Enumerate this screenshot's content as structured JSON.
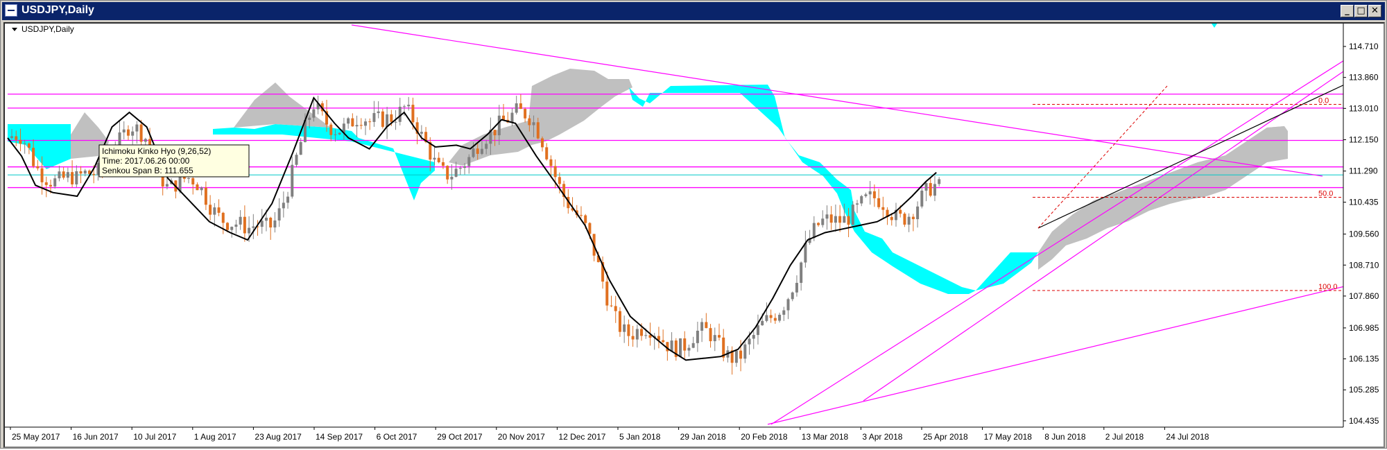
{
  "window": {
    "title": "USDJPY,Daily",
    "buttons": [
      "_",
      "□",
      "✕"
    ]
  },
  "chart_label": "USDJPY,Daily",
  "tooltip": {
    "line1": "Ichimoku Kinko Hyo (9,26,52)",
    "line2": "Time: 2017.06.26 00:00",
    "line3": "Senkou Span B: 111.655"
  },
  "colors": {
    "kumo_bull": "#00ffff",
    "kumo_bear": "#c0c0c0",
    "hline": "#ff00ff",
    "kijun": "#000000",
    "tenkan": "#dd1111",
    "candle_up": "#808080",
    "candle_down": "#e07020",
    "fib": "#dd0000"
  },
  "chart_data": {
    "type": "candlestick",
    "symbol": "USDJPY",
    "timeframe": "Daily",
    "ylim": [
      104.3,
      115.3
    ],
    "y_ticks": [
      "114.710",
      "113.860",
      "113.010",
      "112.150",
      "111.290",
      "110.435",
      "109.560",
      "108.710",
      "107.860",
      "106.985",
      "106.135",
      "105.285",
      "104.435"
    ],
    "x_ticks": [
      "25 May 2017",
      "16 Jun 2017",
      "10 Jul 2017",
      "1 Aug 2017",
      "23 Aug 2017",
      "14 Sep 2017",
      "6 Oct 2017",
      "29 Oct 2017",
      "20 Nov 2017",
      "12 Dec 2017",
      "5 Jan 2018",
      "29 Jan 2018",
      "20 Feb 2018",
      "13 Mar 2018",
      "3 Apr 2018",
      "25 Apr 2018",
      "17 May 2018",
      "8 Jun 2018",
      "2 Jul 2018",
      "24 Jul 2018"
    ],
    "price_levels": [
      {
        "label": "113.401",
        "value": 113.401
      },
      {
        "label": "113.018",
        "value": 113.018
      },
      {
        "label": "112.131",
        "value": 112.131
      },
      {
        "label": "111.405",
        "value": 111.405
      },
      {
        "label": "110.836",
        "value": 110.836
      }
    ],
    "current_price": {
      "label": "111.064",
      "value": 111.064
    },
    "fibonacci": [
      {
        "label": "0.0",
        "value": 113.12
      },
      {
        "label": "50.0",
        "value": 110.57
      },
      {
        "label": "100.0",
        "value": 108.01
      }
    ],
    "kijun": [
      [
        0,
        112.2
      ],
      [
        20,
        111.7
      ],
      [
        40,
        110.9
      ],
      [
        65,
        110.7
      ],
      [
        100,
        110.6
      ],
      [
        125,
        111.4
      ],
      [
        150,
        112.5
      ],
      [
        175,
        112.9
      ],
      [
        200,
        112.5
      ],
      [
        230,
        111.1
      ],
      [
        260,
        110.5
      ],
      [
        290,
        109.9
      ],
      [
        320,
        109.6
      ],
      [
        345,
        109.4
      ],
      [
        380,
        110.4
      ],
      [
        410,
        111.8
      ],
      [
        440,
        113.3
      ],
      [
        470,
        112.6
      ],
      [
        490,
        112.2
      ],
      [
        520,
        111.9
      ],
      [
        545,
        112.5
      ],
      [
        570,
        112.9
      ],
      [
        595,
        112.2
      ],
      [
        615,
        111.95
      ],
      [
        645,
        112.0
      ],
      [
        665,
        111.9
      ],
      [
        690,
        112.3
      ],
      [
        710,
        112.7
      ],
      [
        730,
        112.6
      ],
      [
        760,
        111.7
      ],
      [
        790,
        110.9
      ],
      [
        830,
        109.8
      ],
      [
        865,
        108.3
      ],
      [
        895,
        107.3
      ],
      [
        925,
        106.8
      ],
      [
        950,
        106.4
      ],
      [
        975,
        106.1
      ],
      [
        1000,
        106.15
      ],
      [
        1025,
        106.2
      ],
      [
        1050,
        106.4
      ],
      [
        1075,
        107.0
      ],
      [
        1100,
        107.8
      ],
      [
        1125,
        108.7
      ],
      [
        1150,
        109.4
      ],
      [
        1175,
        109.6
      ],
      [
        1200,
        109.7
      ],
      [
        1225,
        109.8
      ],
      [
        1250,
        109.9
      ],
      [
        1275,
        110.15
      ],
      [
        1300,
        110.6
      ],
      [
        1320,
        111.0
      ],
      [
        1335,
        111.25
      ]
    ]
  }
}
